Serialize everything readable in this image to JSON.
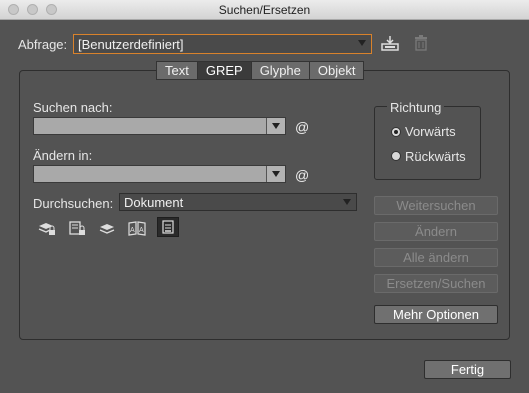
{
  "window": {
    "title": "Suchen/Ersetzen"
  },
  "query": {
    "label": "Abfrage:",
    "value": "[Benutzerdefiniert]",
    "save_icon": "save-query-icon",
    "delete_icon": "trash-icon"
  },
  "tabs": [
    {
      "label": "Text",
      "active": false
    },
    {
      "label": "GREP",
      "active": true
    },
    {
      "label": "Glyphe",
      "active": false
    },
    {
      "label": "Objekt",
      "active": false
    }
  ],
  "search": {
    "label": "Suchen nach:",
    "value": "",
    "special": "@"
  },
  "replace": {
    "label": "Ändern in:",
    "value": "",
    "special": "@"
  },
  "scope": {
    "label": "Durchsuchen:",
    "value": "Dokument"
  },
  "direction": {
    "title": "Richtung",
    "options": [
      {
        "label": "Vorwärts",
        "checked": true
      },
      {
        "label": "Rückwärts",
        "checked": false
      }
    ]
  },
  "buttons": {
    "find_next": "Weitersuchen",
    "change": "Ändern",
    "change_all": "Alle ändern",
    "change_find": "Ersetzen/Suchen",
    "more_options": "Mehr Optionen",
    "done": "Fertig"
  },
  "option_icons": [
    "locked-layers-icon",
    "locked-stories-icon",
    "hidden-layers-icon",
    "master-pages-icon",
    "footnotes-icon"
  ]
}
